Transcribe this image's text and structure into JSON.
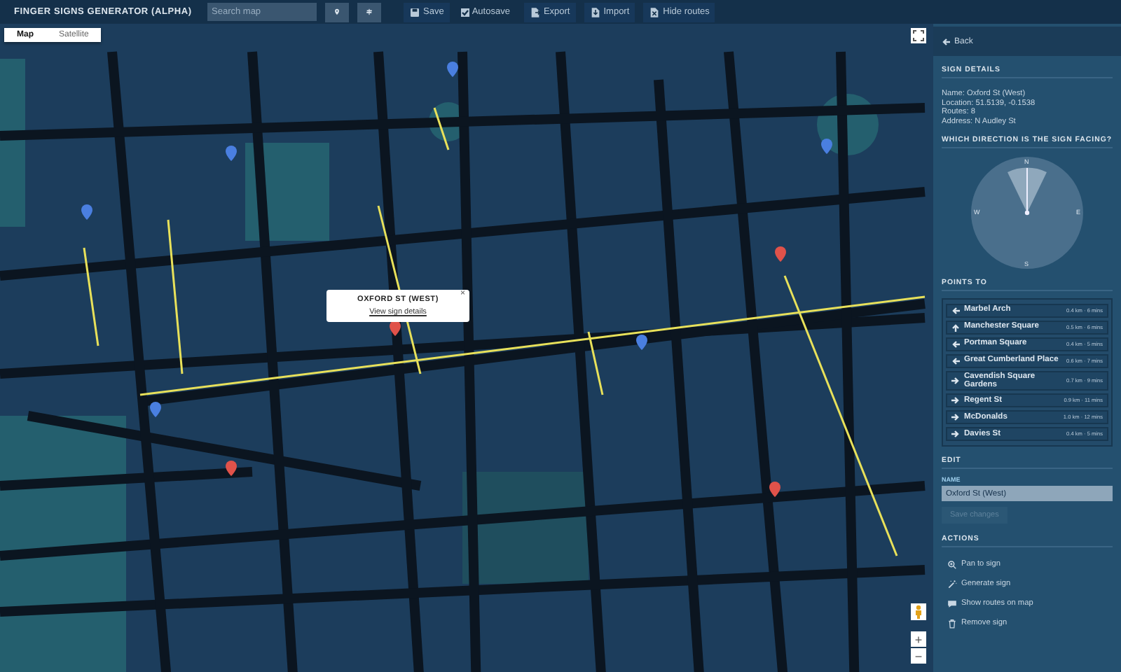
{
  "app": {
    "title": "FINGER SIGNS GENERATOR (ALPHA)"
  },
  "toolbar": {
    "search": {
      "placeholder": "Search map"
    },
    "buttons": [
      {
        "kind": "icon"
      },
      {
        "kind": "icon"
      },
      {
        "kind": "text",
        "label": "Save"
      },
      {
        "kind": "check",
        "label": "Autosave",
        "checked": true
      },
      {
        "kind": "text",
        "label": "Export"
      },
      {
        "kind": "text",
        "label": "Import"
      },
      {
        "kind": "text",
        "label": "Hide routes"
      }
    ]
  },
  "map": {
    "type_tabs": [
      {
        "label": "Map",
        "selected": true
      },
      {
        "label": "Satellite",
        "selected": false
      }
    ],
    "markers": [
      {
        "color": "#4a7fe0"
      },
      {
        "color": "#4a7fe0"
      },
      {
        "color": "#4a7fe0"
      },
      {
        "color": "#4a7fe0"
      },
      {
        "color": "#4a7fe0"
      },
      {
        "color": "#4a7fe0"
      },
      {
        "color": "#e0524a"
      },
      {
        "color": "#e0524a"
      },
      {
        "color": "#e0524a"
      },
      {
        "color": "#e0524a"
      }
    ],
    "popup": {
      "title": "OXFORD ST (WEST)",
      "link": "View sign details",
      "close": "×"
    },
    "zoom": {
      "in": "+",
      "out": "−"
    }
  },
  "panel": {
    "back": "Back",
    "details": {
      "heading": "SIGN DETAILS",
      "lines": [
        "Name: Oxford St (West)",
        "Location: 51.5139, -0.1538",
        "Routes: 8",
        "Address: N Audley St"
      ]
    },
    "direction": {
      "heading": "WHICH DIRECTION IS THE SIGN FACING?",
      "compass": [
        "N",
        "E",
        "S",
        "W"
      ]
    },
    "points_to": {
      "heading": "POINTS TO",
      "items": [
        {
          "kind": "left",
          "name": "Marbel Arch",
          "distance": "0.4 km · 6 mins"
        },
        {
          "kind": "up",
          "name": "Manchester Square",
          "distance": "0.5 km · 6 mins"
        },
        {
          "kind": "left",
          "name": "Portman Square",
          "distance": "0.4 km · 5 mins"
        },
        {
          "kind": "left",
          "name": "Great Cumberland Place",
          "distance": "0.6 km · 7 mins"
        },
        {
          "kind": "right",
          "name": "Cavendish Square Gardens",
          "distance": "0.7 km · 9 mins"
        },
        {
          "kind": "right",
          "name": "Regent St",
          "distance": "0.9 km · 11 mins"
        },
        {
          "kind": "right",
          "name": "McDonalds",
          "distance": "1.0 km · 12 mins"
        },
        {
          "kind": "right",
          "name": "Davies St",
          "distance": "0.4 km · 5 mins"
        }
      ]
    },
    "edit": {
      "heading": "EDIT",
      "name_label": "NAME",
      "name_value": "Oxford St (West)",
      "save": {
        "label": "Save changes",
        "disabled": true
      }
    },
    "actions": {
      "heading": "ACTIONS",
      "items": [
        {
          "label": "Pan to sign"
        },
        {
          "label": "Generate sign"
        },
        {
          "label": "Show routes on map"
        },
        {
          "label": "Remove sign"
        }
      ]
    }
  }
}
